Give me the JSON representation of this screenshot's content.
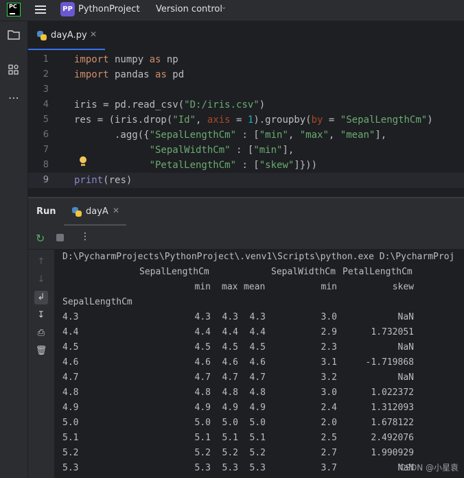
{
  "titlebar": {
    "app_logo_text": "PC",
    "project_badge": "PP",
    "project_name": "PythonProject",
    "vcs_label": "Version control"
  },
  "editor_tab": {
    "filename": "dayA.py"
  },
  "editor": {
    "line_numbers": [
      "1",
      "2",
      "3",
      "4",
      "5",
      "6",
      "7",
      "8",
      "9"
    ],
    "current_line": 9
  },
  "run_panel": {
    "title": "Run",
    "tab_label": "dayA"
  },
  "console": {
    "command": "D:\\PycharmProjects\\PythonProject\\.venv1\\Scripts\\python.exe D:\\PycharmProj",
    "header_row1": {
      "sepal_length": "SepalLengthCm",
      "sepal_width": "SepalWidthCm",
      "petal_length": "PetalLengthCm"
    },
    "header_row2": {
      "min": "min",
      "max": "max",
      "mean": "mean",
      "sw_min": "min",
      "skew": "skew"
    },
    "index_name": "SepalLengthCm",
    "rows": [
      {
        "idx": "4.3",
        "min": "4.3",
        "max": "4.3",
        "mean": "4.3",
        "sw_min": "3.0",
        "skew": "NaN"
      },
      {
        "idx": "4.4",
        "min": "4.4",
        "max": "4.4",
        "mean": "4.4",
        "sw_min": "2.9",
        "skew": "1.732051"
      },
      {
        "idx": "4.5",
        "min": "4.5",
        "max": "4.5",
        "mean": "4.5",
        "sw_min": "2.3",
        "skew": "NaN"
      },
      {
        "idx": "4.6",
        "min": "4.6",
        "max": "4.6",
        "mean": "4.6",
        "sw_min": "3.1",
        "skew": "-1.719868"
      },
      {
        "idx": "4.7",
        "min": "4.7",
        "max": "4.7",
        "mean": "4.7",
        "sw_min": "3.2",
        "skew": "NaN"
      },
      {
        "idx": "4.8",
        "min": "4.8",
        "max": "4.8",
        "mean": "4.8",
        "sw_min": "3.0",
        "skew": "1.022372"
      },
      {
        "idx": "4.9",
        "min": "4.9",
        "max": "4.9",
        "mean": "4.9",
        "sw_min": "2.4",
        "skew": "1.312093"
      },
      {
        "idx": "5.0",
        "min": "5.0",
        "max": "5.0",
        "mean": "5.0",
        "sw_min": "2.0",
        "skew": "1.678122"
      },
      {
        "idx": "5.1",
        "min": "5.1",
        "max": "5.1",
        "mean": "5.1",
        "sw_min": "2.5",
        "skew": "2.492076"
      },
      {
        "idx": "5.2",
        "min": "5.2",
        "max": "5.2",
        "mean": "5.2",
        "sw_min": "2.7",
        "skew": "1.990929"
      },
      {
        "idx": "5.3",
        "min": "5.3",
        "max": "5.3",
        "mean": "5.3",
        "sw_min": "3.7",
        "skew": "NaN"
      }
    ]
  },
  "watermark": "CSDN @小星袁",
  "colors": {
    "background": "#1e1f22",
    "panel": "#2b2d30",
    "keyword": "#cf8e6d",
    "string": "#6aab73",
    "number": "#2aacb8",
    "accent_tab": "#3574f0",
    "project_badge": "#6b57d2"
  },
  "icons": {
    "toolstrip": [
      "folder-icon",
      "structure-icon",
      "more-tools-icon"
    ],
    "run_toolbar": [
      "rerun-icon",
      "stop-icon",
      "more-options-icon"
    ],
    "run_gutter": [
      "scroll-up-icon",
      "scroll-down-icon",
      "soft-wrap-icon",
      "scroll-to-end-icon",
      "print-icon",
      "trash-icon"
    ]
  }
}
